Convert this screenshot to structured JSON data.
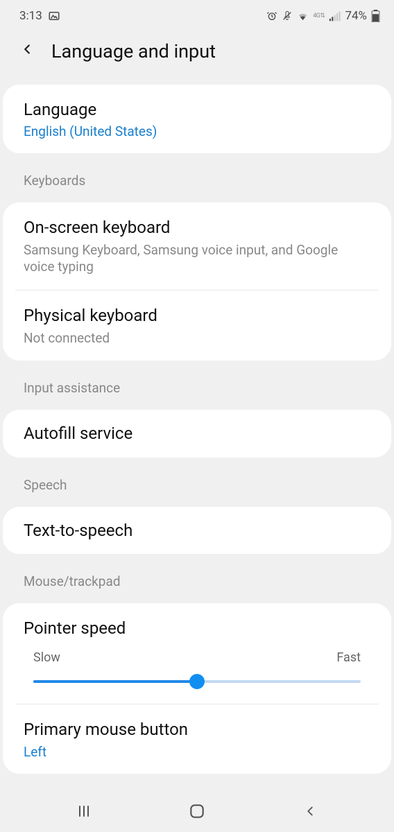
{
  "status": {
    "time": "3:13",
    "battery": "74%"
  },
  "header": {
    "title": "Language and input"
  },
  "language": {
    "title": "Language",
    "value": "English (United States)"
  },
  "sections": {
    "keyboards": "Keyboards",
    "input_assistance": "Input assistance",
    "speech": "Speech",
    "mouse": "Mouse/trackpad"
  },
  "keyboards": {
    "onscreen": {
      "title": "On-screen keyboard",
      "sub": "Samsung Keyboard, Samsung voice input, and Google voice typing"
    },
    "physical": {
      "title": "Physical keyboard",
      "sub": "Not connected"
    }
  },
  "autofill": {
    "title": "Autofill service"
  },
  "tts": {
    "title": "Text-to-speech"
  },
  "pointer": {
    "title": "Pointer speed",
    "slow": "Slow",
    "fast": "Fast"
  },
  "mouse_button": {
    "title": "Primary mouse button",
    "value": "Left"
  }
}
